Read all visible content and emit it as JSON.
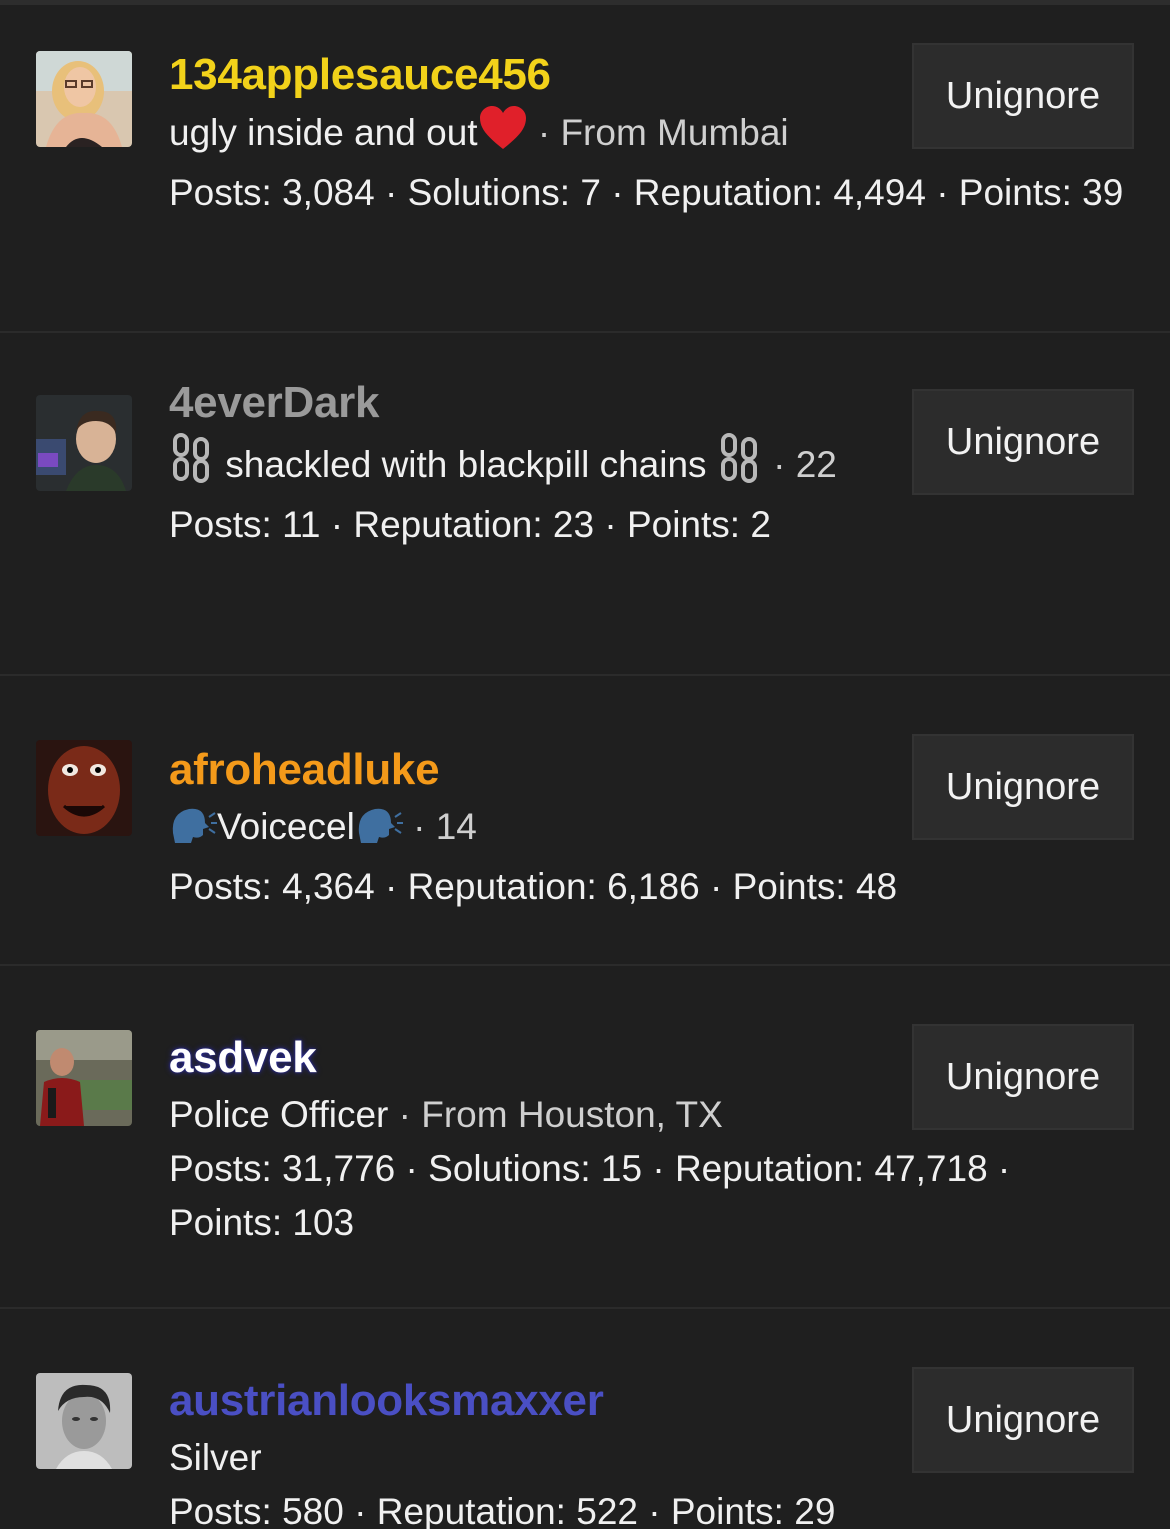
{
  "users": [
    {
      "username": "134applesauce456",
      "name_color": "#f2d21a",
      "title": "ugly inside and out",
      "title_icon": "red-heart-icon",
      "meta": "· From Mumbai",
      "stats": "Posts: 3,084 · Solutions: 7 · Reputation: 4,494 · Points: 39",
      "button": "Unignore"
    },
    {
      "username": "4everDark",
      "name_color": "#9a9a9a",
      "title_prefix_icon": "chains-icon",
      "title": "shackled with blackpill chains",
      "title_suffix_icon": "chains-icon",
      "meta": "· 22",
      "stats": "Posts: 11 · Reputation: 23 · Points: 2",
      "button": "Unignore"
    },
    {
      "username": "afroheadluke",
      "name_color": "#f49a1a",
      "title_prefix_icon": "speaking-head-icon",
      "title": "Voicecel",
      "title_suffix_icon": "speaking-head-icon",
      "meta": "· 14",
      "stats": "Posts: 4,364 · Reputation: 6,186 · Points: 48",
      "button": "Unignore"
    },
    {
      "username": "asdvek",
      "name_color": "#ffffff",
      "name_glow": "#2a2a8a",
      "title": "Police Officer",
      "meta": "· From Houston, TX",
      "stats": "Posts: 31,776 · Solutions: 15 · Reputation: 47,718 · Points: 103",
      "button": "Unignore"
    },
    {
      "username": "austrianlooksmaxxer",
      "name_color": "#4a4fc4",
      "title": "Silver",
      "stats": "Posts: 580 · Reputation: 522 · Points: 29",
      "button": "Unignore"
    }
  ]
}
